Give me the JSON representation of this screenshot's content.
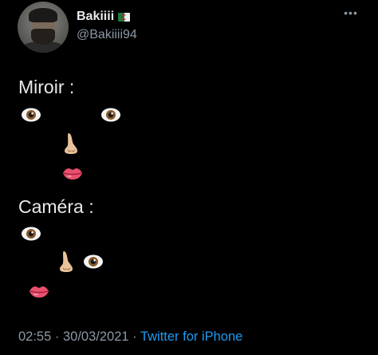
{
  "author": {
    "display_name": "Bakiiii",
    "flag_icon": "algeria-flag-icon",
    "handle": "@Bakiiii94"
  },
  "more_icon": "•••",
  "tweet": {
    "line1": "Miroir :",
    "line2": "Caméra :"
  },
  "footer": {
    "time": "02:55",
    "separator1": " · ",
    "date": "30/03/2021",
    "separator2": " · ",
    "source": "Twitter for iPhone"
  },
  "colors": {
    "background": "#000000",
    "text": "#e7e9ea",
    "secondary": "#8b98a5",
    "link": "#1d9bf0"
  }
}
